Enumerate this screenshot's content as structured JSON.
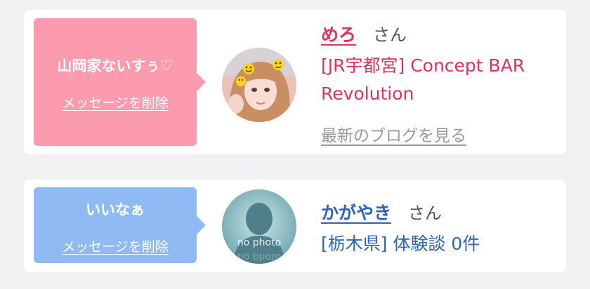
{
  "favorites": [
    {
      "message": "山岡家ないすぅ♡",
      "delete_label": "メッセージを削除",
      "name": "めろ",
      "honorific": "さん",
      "shop": "[JR宇都宮] Concept BAR Revolution",
      "blog_link": "最新のブログを見る",
      "accent_color": "#fb9bad"
    },
    {
      "message": "いいなぁ",
      "delete_label": "メッセージを削除",
      "name": "かがやき",
      "honorific": "さん",
      "prefecture": "[栃木県]",
      "review_count": "体験談 0件",
      "avatar_placeholder": "no photo",
      "accent_color": "#8fbaf4"
    }
  ]
}
